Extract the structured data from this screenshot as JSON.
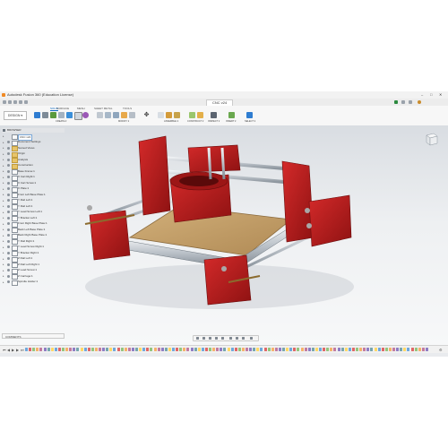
{
  "app": {
    "window_title": "Autodesk Fusion 360 (Education License)",
    "doc_tab": "CNC v24",
    "win_controls": [
      "–",
      "□",
      "✕"
    ]
  },
  "ribbon": {
    "workspace": "DESIGN ▾",
    "tabs": [
      "SOLID",
      "SURFACE",
      "MESH",
      "SHEET METAL",
      "TOOLS"
    ],
    "active_tab": "SOLID",
    "groups": [
      "CREATE ▾",
      "MODIFY ▾",
      "ASSEMBLE ▾",
      "CONSTRUCT ▾",
      "INSPECT ▾",
      "INSERT ▾",
      "SELECT ▾"
    ]
  },
  "browser": {
    "header": "BROWSER",
    "items": [
      {
        "label": "CNC v24",
        "type": "root",
        "selected": true
      },
      {
        "label": "Document Settings",
        "type": "settings"
      },
      {
        "label": "Named Views",
        "type": "folder"
      },
      {
        "label": "Origin",
        "type": "folder"
      },
      {
        "label": "Analysis",
        "type": "folder"
      },
      {
        "label": "Construction",
        "type": "folder"
      },
      {
        "label": "Base Frame:1",
        "type": "component"
      },
      {
        "label": "X Cart Right:1",
        "type": "component"
      },
      {
        "label": "X Cart Screw:1",
        "type": "component"
      },
      {
        "label": "X Plate:1",
        "type": "component"
      },
      {
        "label": "Front Left Base Plate:1",
        "type": "component"
      },
      {
        "label": "Y Rail Left:1",
        "type": "component"
      },
      {
        "label": "Y Rail Left:1",
        "type": "component"
      },
      {
        "label": "Y Lead Screw Left:1",
        "type": "component"
      },
      {
        "label": "Y Bracket Left:1",
        "type": "component"
      },
      {
        "label": "Front Right Base Plate:1",
        "type": "component"
      },
      {
        "label": "Back Left Base Plate:1",
        "type": "component"
      },
      {
        "label": "Back Right Base Plate:1",
        "type": "component"
      },
      {
        "label": "Y Rail Right:1",
        "type": "component"
      },
      {
        "label": "Y Lead Screw Right:1",
        "type": "component"
      },
      {
        "label": "Y Bracket Right:1",
        "type": "component"
      },
      {
        "label": "Z Rail Left:1",
        "type": "component"
      },
      {
        "label": "Z Rail Left Right:1",
        "type": "component"
      },
      {
        "label": "Z Lead Screw:1",
        "type": "component"
      },
      {
        "label": "Z Carriage:1",
        "type": "component"
      },
      {
        "label": "Spindle Holder:1",
        "type": "component"
      }
    ]
  },
  "comments": {
    "label": "COMMENTS"
  },
  "timeline": {
    "controls": [
      "⏮",
      "◀",
      "▶",
      "▶",
      "⏭"
    ],
    "feature_colors": [
      "#6fa8dc",
      "#e06666",
      "#93c47d",
      "#f6b26b",
      "#c27ba0",
      "#8e7cc3",
      "#76a5af",
      "#ffd966"
    ]
  },
  "colors": {
    "part_red": "#b81c1c",
    "bed_wood": "#c8a46a",
    "rail_steel": "#c9ced3",
    "accent": "#0a67c2"
  }
}
